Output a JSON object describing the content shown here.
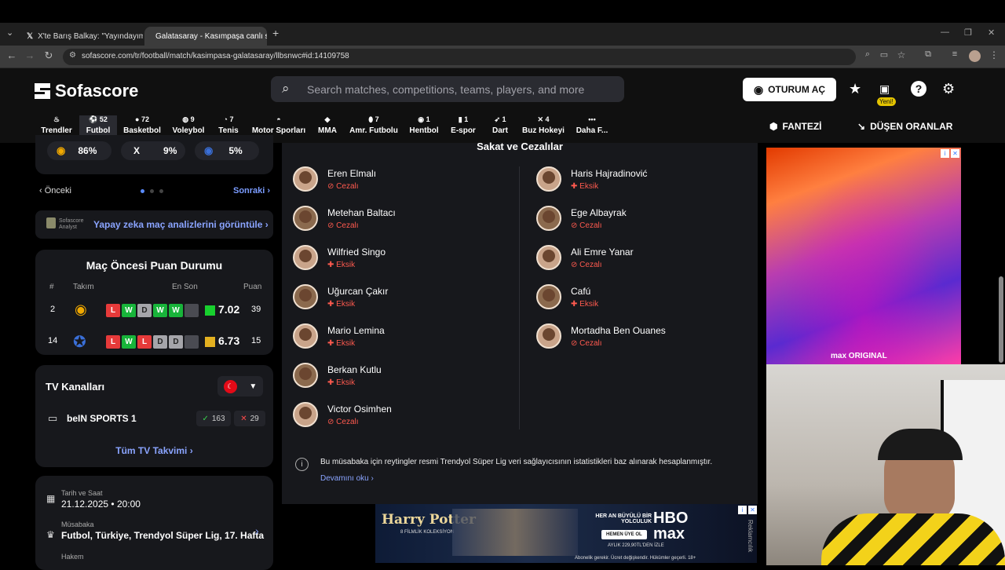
{
  "browser": {
    "tabs": [
      {
        "title": "X'te Barış Balkay: \"Yayındayım. I",
        "active": false
      },
      {
        "title": "Galatasaray - Kasımpaşa canlı s",
        "active": true
      }
    ],
    "url": "sofascore.com/tr/football/match/kasimpasa-galatasaray/llbsnwc#id:14109758"
  },
  "header": {
    "logo": "Sofascore",
    "search_placeholder": "Search matches, competitions, teams, players, and more",
    "login_label": "OTURUM AÇ",
    "yeni_badge": "Yeni!",
    "fantezi": "FANTEZİ",
    "dusen_oranlar": "DÜŞEN ORANLAR",
    "sports": [
      {
        "label": "Trendler",
        "count": ""
      },
      {
        "label": "Futbol",
        "count": "52"
      },
      {
        "label": "Basketbol",
        "count": "72"
      },
      {
        "label": "Voleybol",
        "count": "9"
      },
      {
        "label": "Tenis",
        "count": "7"
      },
      {
        "label": "Motor Sporları",
        "count": ""
      },
      {
        "label": "MMA",
        "count": ""
      },
      {
        "label": "Amr. Futbolu",
        "count": "7"
      },
      {
        "label": "Hentbol",
        "count": "1"
      },
      {
        "label": "E-spor",
        "count": "1"
      },
      {
        "label": "Dart",
        "count": "1"
      },
      {
        "label": "Buz Hokeyi",
        "count": "4"
      },
      {
        "label": "Daha F...",
        "count": ""
      }
    ]
  },
  "sidebar": {
    "odds": {
      "home": "86%",
      "draw_label": "X",
      "draw": "9%",
      "away": "5%"
    },
    "prev": "Önceki",
    "next": "Sonraki",
    "analyst_brand": "Sofascore Analyst",
    "ai_link": "Yapay zeka maç analizlerini görüntüle",
    "standings": {
      "title": "Maç Öncesi Puan Durumu",
      "headers": {
        "rank": "#",
        "team": "Takım",
        "form": "En Son",
        "points": "Puan"
      },
      "rows": [
        {
          "rank": "2",
          "form": [
            "L",
            "W",
            "D",
            "W",
            "W",
            ""
          ],
          "rating": "7.02",
          "rating_color": "#18d02e",
          "points": "39"
        },
        {
          "rank": "14",
          "form": [
            "L",
            "W",
            "L",
            "D",
            "D",
            ""
          ],
          "rating": "6.73",
          "rating_color": "#e3b020",
          "points": "15"
        }
      ]
    },
    "tv": {
      "title": "TV Kanalları",
      "channel": "beIN SPORTS 1",
      "up": "163",
      "down": "29",
      "all_link": "Tüm TV Takvimi"
    },
    "info": {
      "date_label": "Tarih ve Saat",
      "date": "21.12.2025",
      "time": "20:00",
      "comp_label": "Müsabaka",
      "comp": "Futbol, Türkiye, Trendyol Süper Lig, 17. Hafta",
      "referee_label": "Hakem"
    }
  },
  "injuries": {
    "title": "Sakat ve Cezalılar",
    "left": [
      {
        "name": "Eren Elmalı",
        "status": "Cezalı",
        "type": "ban"
      },
      {
        "name": "Metehan Baltacı",
        "status": "Cezalı",
        "type": "ban"
      },
      {
        "name": "Wilfried Singo",
        "status": "Eksik",
        "type": "injury"
      },
      {
        "name": "Uğurcan Çakır",
        "status": "Eksik",
        "type": "injury"
      },
      {
        "name": "Mario Lemina",
        "status": "Eksik",
        "type": "injury"
      },
      {
        "name": "Berkan Kutlu",
        "status": "Eksik",
        "type": "injury"
      },
      {
        "name": "Victor Osimhen",
        "status": "Cezalı",
        "type": "ban"
      }
    ],
    "right": [
      {
        "name": "Haris Hajradinović",
        "status": "Eksik",
        "type": "injury"
      },
      {
        "name": "Ege Albayrak",
        "status": "Cezalı",
        "type": "ban"
      },
      {
        "name": "Ali Emre Yanar",
        "status": "Cezalı",
        "type": "ban"
      },
      {
        "name": "Cafú",
        "status": "Eksik",
        "type": "injury"
      },
      {
        "name": "Mortadha Ben Ouanes",
        "status": "Cezalı",
        "type": "ban"
      }
    ],
    "note": "Bu müsabaka için reytingler resmi Trendyol Süper Lig veri sağlayıcısının istatistikleri baz alınarak hesaplanmıştır.",
    "more": "Devamını oku"
  },
  "ads": {
    "side_label": "max ORIGINAL",
    "banner_left": "Harry Potter",
    "banner_sub": "8 FİLMLİK KOLEKSİYON",
    "banner_mid": "HER AN BÜYÜLÜ BİR YOLCULUK",
    "banner_btn": "HEMEN ÜYE OL",
    "banner_price": "AYLIK 229,90TL'DEN İZLE",
    "banner_logo": "HBO max",
    "banner_foot": "Abonelik gerekir. Ücret değişkendir. Hükümler geçerli. 18+",
    "reklam": "Reklamcılık"
  }
}
